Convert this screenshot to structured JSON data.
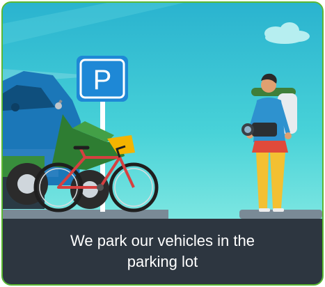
{
  "caption": {
    "text": "We park our vehicles in the parking lot"
  },
  "sign": {
    "letter": "P"
  },
  "colors": {
    "frame": "#5bb832",
    "sky_top": "#2ab3cf",
    "sky_bottom": "#7ce6e1",
    "caption_bg": "#2d3640",
    "sign_blue": "#1e88d6",
    "bicycle": "#d64040"
  },
  "icons": [
    "parking-sign-icon",
    "bicycle-icon",
    "motorcycle-icon",
    "car-icon",
    "traveler-illustration",
    "camera-icon",
    "cloud-icon"
  ]
}
